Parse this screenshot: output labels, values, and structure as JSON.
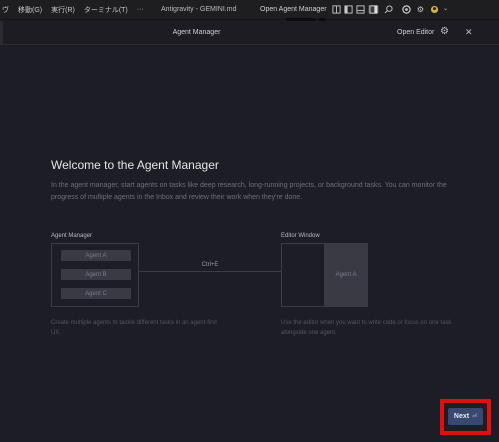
{
  "titlebar": {
    "menus": [
      "ヴ",
      "移動(G)",
      "実行(R)",
      "ターミナル(T)",
      "···"
    ],
    "window_title": "Antigravity - GEMINI.md",
    "open_agent_manager": "Open Agent Manager",
    "icons": [
      "split-icon",
      "sidebar-left-icon",
      "panel-bottom-icon",
      "sidebar-right-icon",
      "search-icon",
      "extensions-icon",
      "settings-icon",
      "account-icon"
    ]
  },
  "header": {
    "title": "Agent Manager",
    "open_editor": "Open Editor",
    "gear": "⚙",
    "close": "✕"
  },
  "welcome": {
    "title": "Welcome to the Agent Manager",
    "description": "In the agent manager, start agents on tasks like deep research, long-running projects, or background tasks. You can monitor the progress of multiple agents in the Inbox and review their work when they're done."
  },
  "diagram": {
    "agent_manager_label": "Agent Manager",
    "agents": [
      "Agent A",
      "Agent B",
      "Agent C"
    ],
    "shortcut": "Ctrl+E",
    "editor_window_label": "Editor Window",
    "editor_agent": "Agent A",
    "left_caption": "Create multiple agents to tackle different tasks in an agent-first UX.",
    "right_caption": "Use the editor when you want to write code or focus on one task alongside one agent."
  },
  "next_button": {
    "label": "Next",
    "key_hint": "⏎"
  },
  "colors": {
    "background": "#1d1d26",
    "next_button": "#3a4870",
    "highlight": "#e01010"
  }
}
